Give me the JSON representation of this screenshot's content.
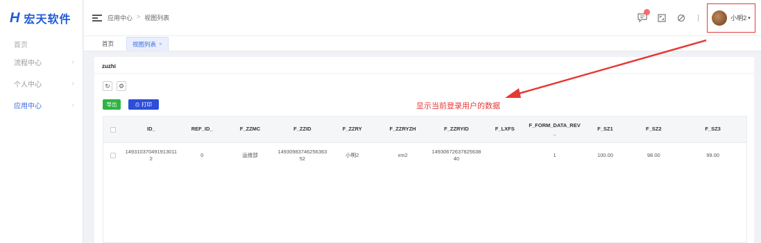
{
  "brand": {
    "logo_mark": "H",
    "name": "宏天软件",
    "color": "#1e5bd8"
  },
  "sidebar": {
    "items": [
      {
        "label": "首页",
        "has_children": false
      },
      {
        "label": "流程中心",
        "has_children": true
      },
      {
        "label": "个人中心",
        "has_children": true
      },
      {
        "label": "应用中心",
        "has_children": true,
        "active": true
      }
    ]
  },
  "header": {
    "breadcrumb": [
      "应用中心",
      "视图列表"
    ],
    "breadcrumb_sep": ">",
    "icons": [
      "message-icon",
      "fullscreen-icon",
      "theme-icon"
    ],
    "user": {
      "name": "小明2",
      "caret": "▾"
    }
  },
  "tabs": [
    {
      "label": "首页",
      "active": false
    },
    {
      "label": "视图列表",
      "active": true,
      "closable": true
    }
  ],
  "page": {
    "title": "zuzhi",
    "buttons": {
      "export": "导出",
      "print": "打印"
    },
    "annotation": "显示当前登录用户的数据",
    "annotation_color": "#e53935"
  },
  "table": {
    "columns": [
      "ID_",
      "REF_ID_",
      "F_ZZMC",
      "F_ZZID",
      "F_ZZRY",
      "F_ZZRYZH",
      "F_ZZRYID",
      "F_LXFS",
      "F_FORM_DATA_REV_",
      "F_SZ1",
      "F_SZ2",
      "F_SZ3"
    ],
    "rows": [
      [
        "1493103704919130112",
        "0",
        "运维部",
        "1493098374625636352",
        "小明2",
        "xm2",
        "1493067263782563840",
        "",
        "1",
        "100.00",
        "98.00",
        "99.00"
      ]
    ]
  }
}
